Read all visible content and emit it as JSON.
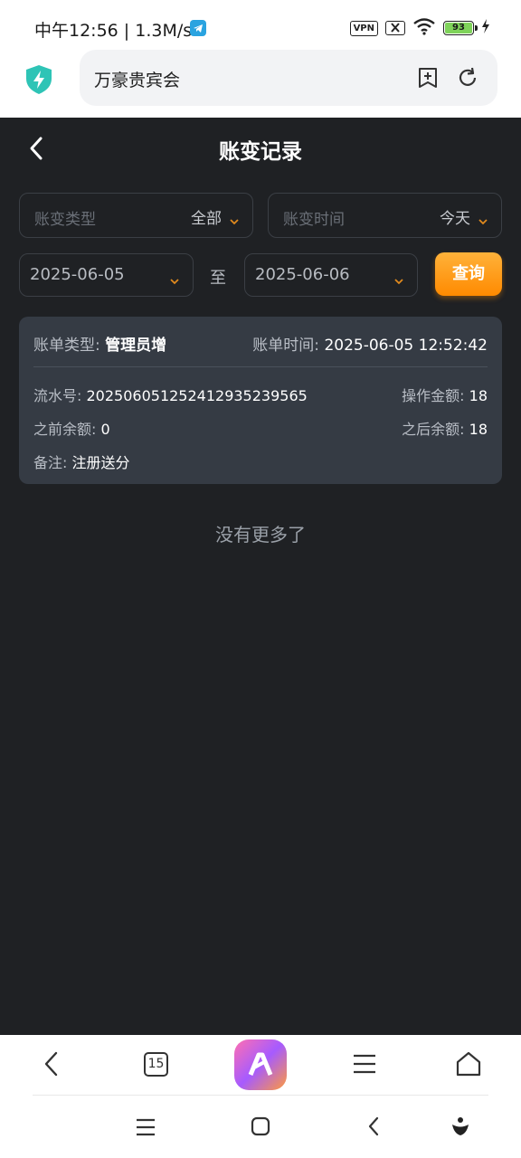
{
  "status_bar": {
    "time": "中午12:56 | 1.3M/s",
    "vpn": "VPN",
    "battery": "93"
  },
  "browser": {
    "url_title": "万豪贵宾会",
    "tab_count": "15"
  },
  "header": {
    "title": "账变记录"
  },
  "filters": {
    "type_label": "账变类型",
    "type_value": "全部",
    "time_label": "账变时间",
    "time_value": "今天"
  },
  "date_range": {
    "start": "2025-06-05",
    "separator": "至",
    "end": "2025-06-06",
    "query_label": "查询"
  },
  "records": [
    {
      "type_label": "账单类型:",
      "type_value": "管理员增",
      "time_label": "账单时间:",
      "time_value": "2025-06-05 12:52:42",
      "serial_label": "流水号:",
      "serial_value": "20250605125241293523956​5",
      "amount_label": "操作金额:",
      "amount_value": "18",
      "before_label": "之前余额:",
      "before_value": "0",
      "after_label": "之后余额:",
      "after_value": "18",
      "note_label": "备注:",
      "note_value": "注册送分"
    }
  ],
  "list_end_text": "没有更多了",
  "colors": {
    "background": "#1f2124",
    "card": "#353b44",
    "accent": "#ff8a00"
  }
}
